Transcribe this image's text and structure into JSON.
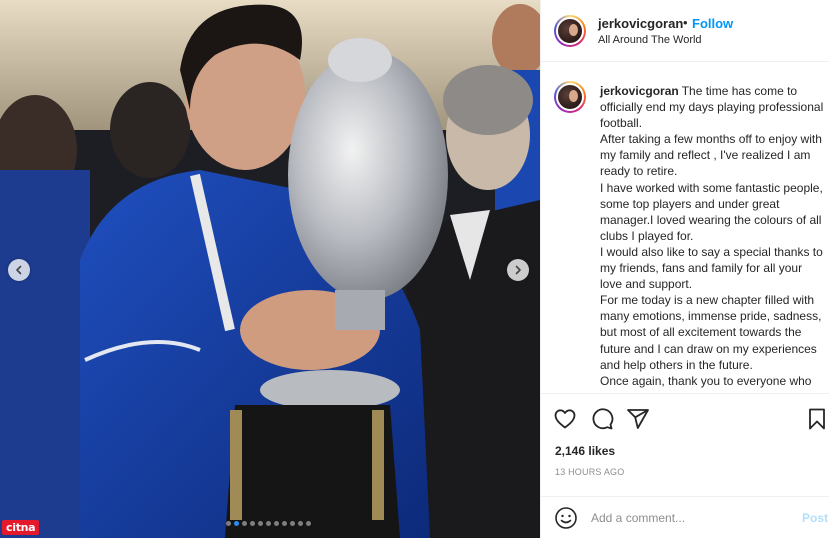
{
  "post": {
    "username": "jerkovicgoran",
    "separator": "•",
    "follow_label": "Follow",
    "location": "All Around The World",
    "caption": "The time has come to officially end my days playing professional football.\nAfter taking a few months off to enjoy with my family and reflect , I've realized I am ready to retire.\nI have worked with some fantastic people, some top players and under great manager.I loved wearing the colours of all clubs I played for.\nI would also like to say a special thanks to my friends, fans and family for all your love and support.\nFor me today is a new chapter filled with many emotions, immense pride, sadness, but most of all excitement towards the future and I can draw on my experiences and help others in the future.\nOnce again, thank you to everyone who",
    "likes": "2,146 likes",
    "time_ago": "13 HOURS AGO"
  },
  "comment": {
    "placeholder": "Add a comment...",
    "post_label": "Post"
  },
  "carousel": {
    "slide_count": 11,
    "active_index": 1
  },
  "watermark": "citna",
  "icons": {
    "prev": "chevron-left-icon",
    "next": "chevron-right-icon",
    "like": "heart-icon",
    "comment": "speech-bubble-icon",
    "share": "paper-plane-icon",
    "save": "bookmark-icon",
    "emoji": "smiley-icon"
  },
  "colors": {
    "accent": "#0095f6",
    "post_disabled": "#b2dffc",
    "muted": "#8e8e8e",
    "carousel_active": "#2d8cf0",
    "watermark_bg": "#e4192c"
  }
}
